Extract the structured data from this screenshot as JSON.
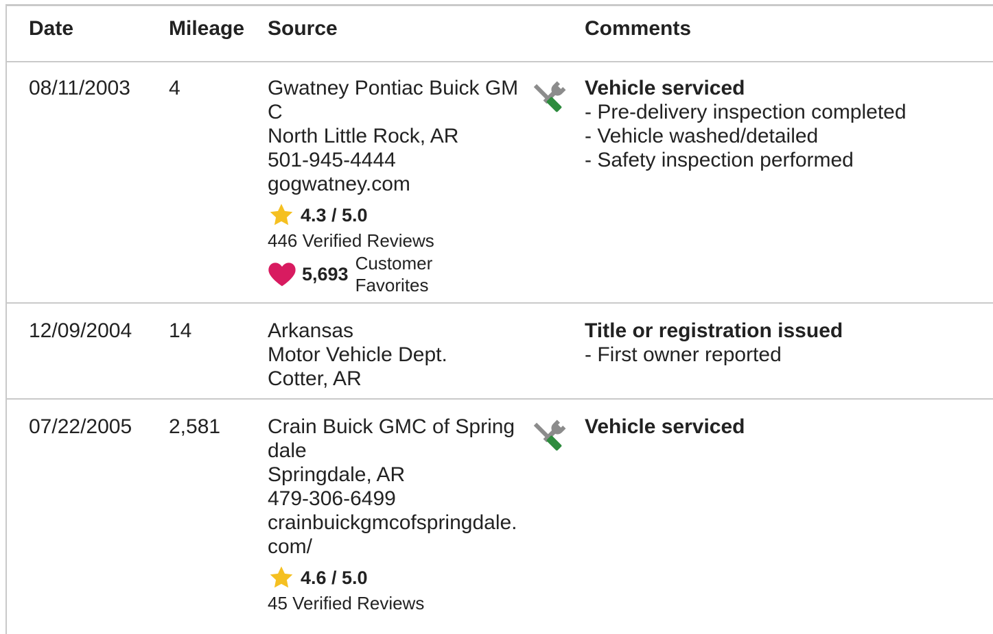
{
  "headers": {
    "date": "Date",
    "mileage": "Mileage",
    "source": "Source",
    "comments": "Comments"
  },
  "records": [
    {
      "date": "08/11/2003",
      "mileage": "4",
      "source": {
        "name": "Gwatney Pontiac Buick GMC",
        "location": "North Little Rock, AR",
        "phone": "501-945-4444",
        "website": "gogwatney.com",
        "rating": "4.3 / 5.0",
        "reviews": "446 Verified Reviews",
        "favorites_count": "5,693",
        "favorites_label": "Customer Favorites"
      },
      "icon": "service-wrench-screwdriver-icon",
      "comment_title": "Vehicle serviced",
      "comment_items": [
        "Pre-delivery inspection completed",
        "Vehicle washed/detailed",
        "Safety inspection performed"
      ]
    },
    {
      "date": "12/09/2004",
      "mileage": "14",
      "source": {
        "name": "Arkansas",
        "location": "Motor Vehicle Dept.",
        "phone": "Cotter, AR"
      },
      "comment_title": "Title or registration issued",
      "comment_items": [
        "First owner reported"
      ]
    },
    {
      "date": "07/22/2005",
      "mileage": "2,581",
      "source": {
        "name": "Crain Buick GMC of Springdale",
        "location": "Springdale, AR",
        "phone": "479-306-6499",
        "website": "crainbuickgmcofspringdale.com/",
        "rating": "4.6 / 5.0",
        "reviews": "45 Verified Reviews"
      },
      "icon": "service-wrench-screwdriver-icon",
      "comment_title": "Vehicle serviced",
      "comment_items": []
    }
  ],
  "colors": {
    "star": "#f5c021",
    "heart": "#d81b60",
    "wrench": "#8c8c8c",
    "screwdriver": "#2e8b3e",
    "border": "#c9c9c9"
  },
  "bullet_prefix": "- "
}
